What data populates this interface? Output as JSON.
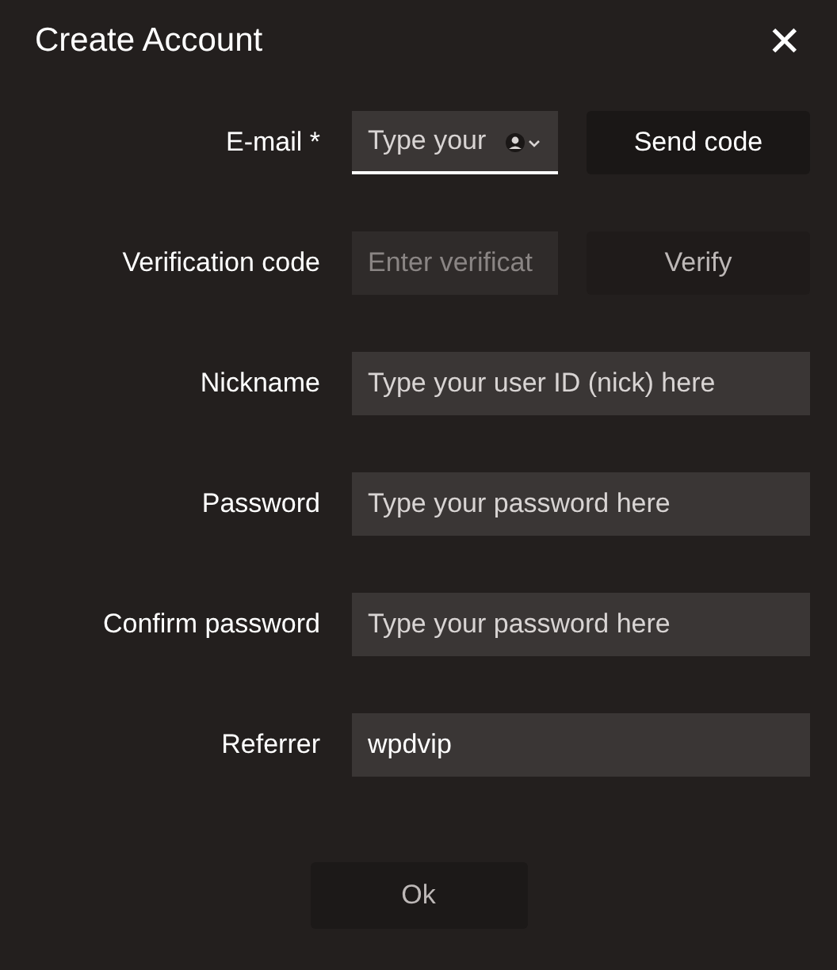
{
  "window": {
    "title": "Create Account",
    "close": "✕"
  },
  "fields": [
    {
      "label": "E-mail *",
      "placeholder": "Type your",
      "focused": true,
      "disabled": false,
      "kind": "email",
      "button": {
        "label": "Send code",
        "disabled": false
      }
    },
    {
      "label": "Verification code",
      "placeholder": "Enter verificat",
      "focused": false,
      "disabled": true,
      "kind": "code",
      "button": {
        "label": "Verify",
        "disabled": true
      }
    },
    {
      "label": "Nickname",
      "placeholder": "Type your user ID (nick) here",
      "focused": false,
      "disabled": false,
      "kind": "text"
    },
    {
      "label": "Password",
      "placeholder": "Type your password here",
      "focused": false,
      "disabled": false,
      "kind": "text"
    },
    {
      "label": "Confirm password",
      "placeholder": "Type your password here",
      "focused": false,
      "disabled": false,
      "kind": "text"
    },
    {
      "label": "Referrer",
      "value": "wpdvip",
      "focused": false,
      "disabled": false,
      "kind": "text"
    }
  ],
  "ok_button": {
    "label": "Ok",
    "disabled": true
  }
}
